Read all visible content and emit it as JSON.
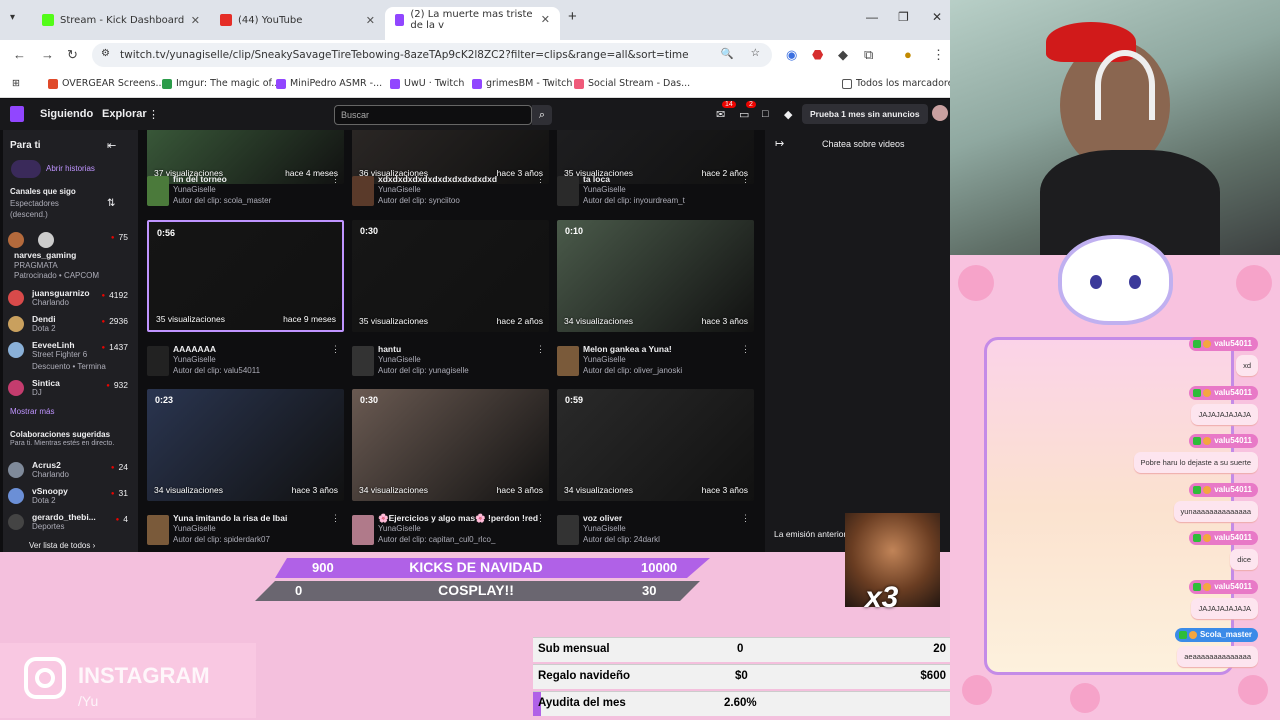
{
  "tabs": [
    {
      "label": "Stream - Kick Dashboard",
      "color": "#1c1c1c"
    },
    {
      "label": "(44) YouTube",
      "color": "#e52d27"
    },
    {
      "label": "(2) La muerte mas triste de la v",
      "color": "#9146ff"
    }
  ],
  "url": "twitch.tv/yunagiselle/clip/SneakySavageTireTebowing-8azeTAp9cK2l8ZC2?filter=clips&range=all&sort=time",
  "bookmarks": [
    "OVERGEAR Screens...",
    "Imgur: The magic of...",
    "MiniPedro ASMR -...",
    "UwU · Twitch",
    "grimesBM - Twitch",
    "Social Stream - Das...",
    "Todos los marcadores"
  ],
  "twitch": {
    "nav": [
      "Siguiendo",
      "Explorar"
    ],
    "search_placeholder": "Buscar",
    "badges": [
      "14",
      "2"
    ],
    "prime": "Prueba 1 mes sin anuncios",
    "sidebar": {
      "for_you": "Para ti",
      "stories": "Abrir historias",
      "channels_header": "Canales que sigo",
      "sort": "Espectadores (descend.)",
      "channels": [
        {
          "name": "narves_gaming",
          "game": "PRAGMATA",
          "extra": "Patrocinado • CAPCOM",
          "viewers": "75",
          "color": "#b46a3c"
        },
        {
          "name": "juansguarnizo",
          "game": "Charlando",
          "viewers": "4192",
          "color": "#d84a4a"
        },
        {
          "name": "Dendi",
          "game": "Dota 2",
          "viewers": "2936",
          "color": "#c9a05e"
        },
        {
          "name": "EeveeLinh",
          "game": "Street Fighter 6",
          "extra": "Descuento • Termina",
          "viewers": "1437",
          "color": "#8ab0d8"
        },
        {
          "name": "Sintica",
          "game": "DJ",
          "viewers": "932",
          "color": "#c43c6e"
        }
      ],
      "more": "Mostrar más",
      "collab_header": "Colaboraciones sugeridas",
      "collab_sub": "Para ti. Mientras estés en directo.",
      "collabs": [
        {
          "name": "Acrus2",
          "game": "Charlando",
          "viewers": "24",
          "color": "#7f8a9a"
        },
        {
          "name": "vSnoopy",
          "game": "Dota 2",
          "viewers": "31",
          "color": "#6b8fd6"
        },
        {
          "name": "gerardo_thebi...",
          "game": "Deportes",
          "viewers": "4",
          "color": "#444"
        }
      ],
      "list_all": "Ver lista de todos"
    },
    "clips": [
      {
        "views": "37 visualizaciones",
        "ago": "hace 4 meses",
        "title": "fin del torneo",
        "channel": "YunaGiselle",
        "author": "Autor del clip: scola_master",
        "bg": "#3a5a3a",
        "ic": "#4b7a3b"
      },
      {
        "views": "36 visualizaciones",
        "ago": "hace 3 años",
        "title": "xdxdxdxdxdxdxdxdxdxdxdxd",
        "channel": "YunaGiselle",
        "author": "Autor del clip: synciitoo",
        "bg": "#2b2725",
        "ic": "#5a3a2a"
      },
      {
        "views": "35 visualizaciones",
        "ago": "hace 2 años",
        "title": "ta loca",
        "channel": "YunaGiselle",
        "author": "Autor del clip: inyourdream_t",
        "bg": "#1e1e20",
        "ic": "#2a2a2a"
      },
      {
        "dur": "0:56",
        "views": "35 visualizaciones",
        "ago": "hace 9 meses",
        "title": "AAAAAAA",
        "channel": "YunaGiselle",
        "author": "Autor del clip: valu54011",
        "bg": "#151515",
        "ic": "#222"
      },
      {
        "dur": "0:30",
        "views": "35 visualizaciones",
        "ago": "hace 2 años",
        "title": "hantu",
        "channel": "YunaGiselle",
        "author": "Autor del clip: yunagiselle",
        "bg": "#161616",
        "ic": "#333"
      },
      {
        "dur": "0:10",
        "views": "34 visualizaciones",
        "ago": "hace 3 años",
        "title": "Melon gankea a Yuna!",
        "channel": "YunaGiselle",
        "author": "Autor del clip: oliver_janoski",
        "bg": "#4a5a4a",
        "ic": "#7a5a3a"
      },
      {
        "dur": "0:23",
        "views": "34 visualizaciones",
        "ago": "hace 3 años",
        "title": "Yuna imitando la risa de Ibai",
        "channel": "YunaGiselle",
        "author": "Autor del clip: spiderdark07",
        "bg": "#2a3550",
        "ic": "#7a5a3a"
      },
      {
        "dur": "0:30",
        "views": "34 visualizaciones",
        "ago": "hace 3 años",
        "title": "🌸Ejercicios y algo mas🌸 !perdon !rede...",
        "channel": "YunaGiselle",
        "author": "Autor del clip: capitan_cul0_rlco_",
        "bg": "#6a5a52",
        "ic": "#b07a8a"
      },
      {
        "dur": "0:59",
        "views": "34 visualizaciones",
        "ago": "hace 3 años",
        "title": "voz oliver",
        "channel": "YunaGiselle",
        "author": "Autor del clip: 24darkl",
        "bg": "#2a2a2a",
        "ic": "#333"
      }
    ],
    "chat_title": "Chatea sobre videos",
    "chat_note": "La emisión anterior ... la repetición de c..."
  },
  "goal": {
    "left_top": "900",
    "title_top": "KICKS DE NAVIDAD",
    "right_top": "10000",
    "left_bottom": "0",
    "title_bottom": "COSPLAY!!",
    "right_bottom": "30"
  },
  "subs": [
    {
      "label": "Sub mensual",
      "mid": "0",
      "right": "20"
    },
    {
      "label": "Regalo navideño",
      "mid": "$0",
      "right": "$600"
    },
    {
      "label": "Ayudita del mes",
      "mid": "2.60%",
      "right": ""
    }
  ],
  "insta": {
    "label": "INSTAGRAM",
    "handle": "/Yu"
  },
  "meme": {
    "label": "x3"
  },
  "chat": [
    {
      "user": "valu54011",
      "msg": "xd"
    },
    {
      "user": "valu54011",
      "msg": "JAJAJAJAJAJA"
    },
    {
      "user": "valu54011",
      "msg": "Pobre haru lo dejaste a su suerte"
    },
    {
      "user": "valu54011",
      "msg": "yunaaaaaaaaaaaaaa"
    },
    {
      "user": "valu54011",
      "msg": "dice"
    },
    {
      "user": "valu54011",
      "msg": "JAJAJAJAJAJA"
    },
    {
      "user": "Scola_master",
      "msg": "aeaaaaaaaaaaaaaa"
    }
  ]
}
